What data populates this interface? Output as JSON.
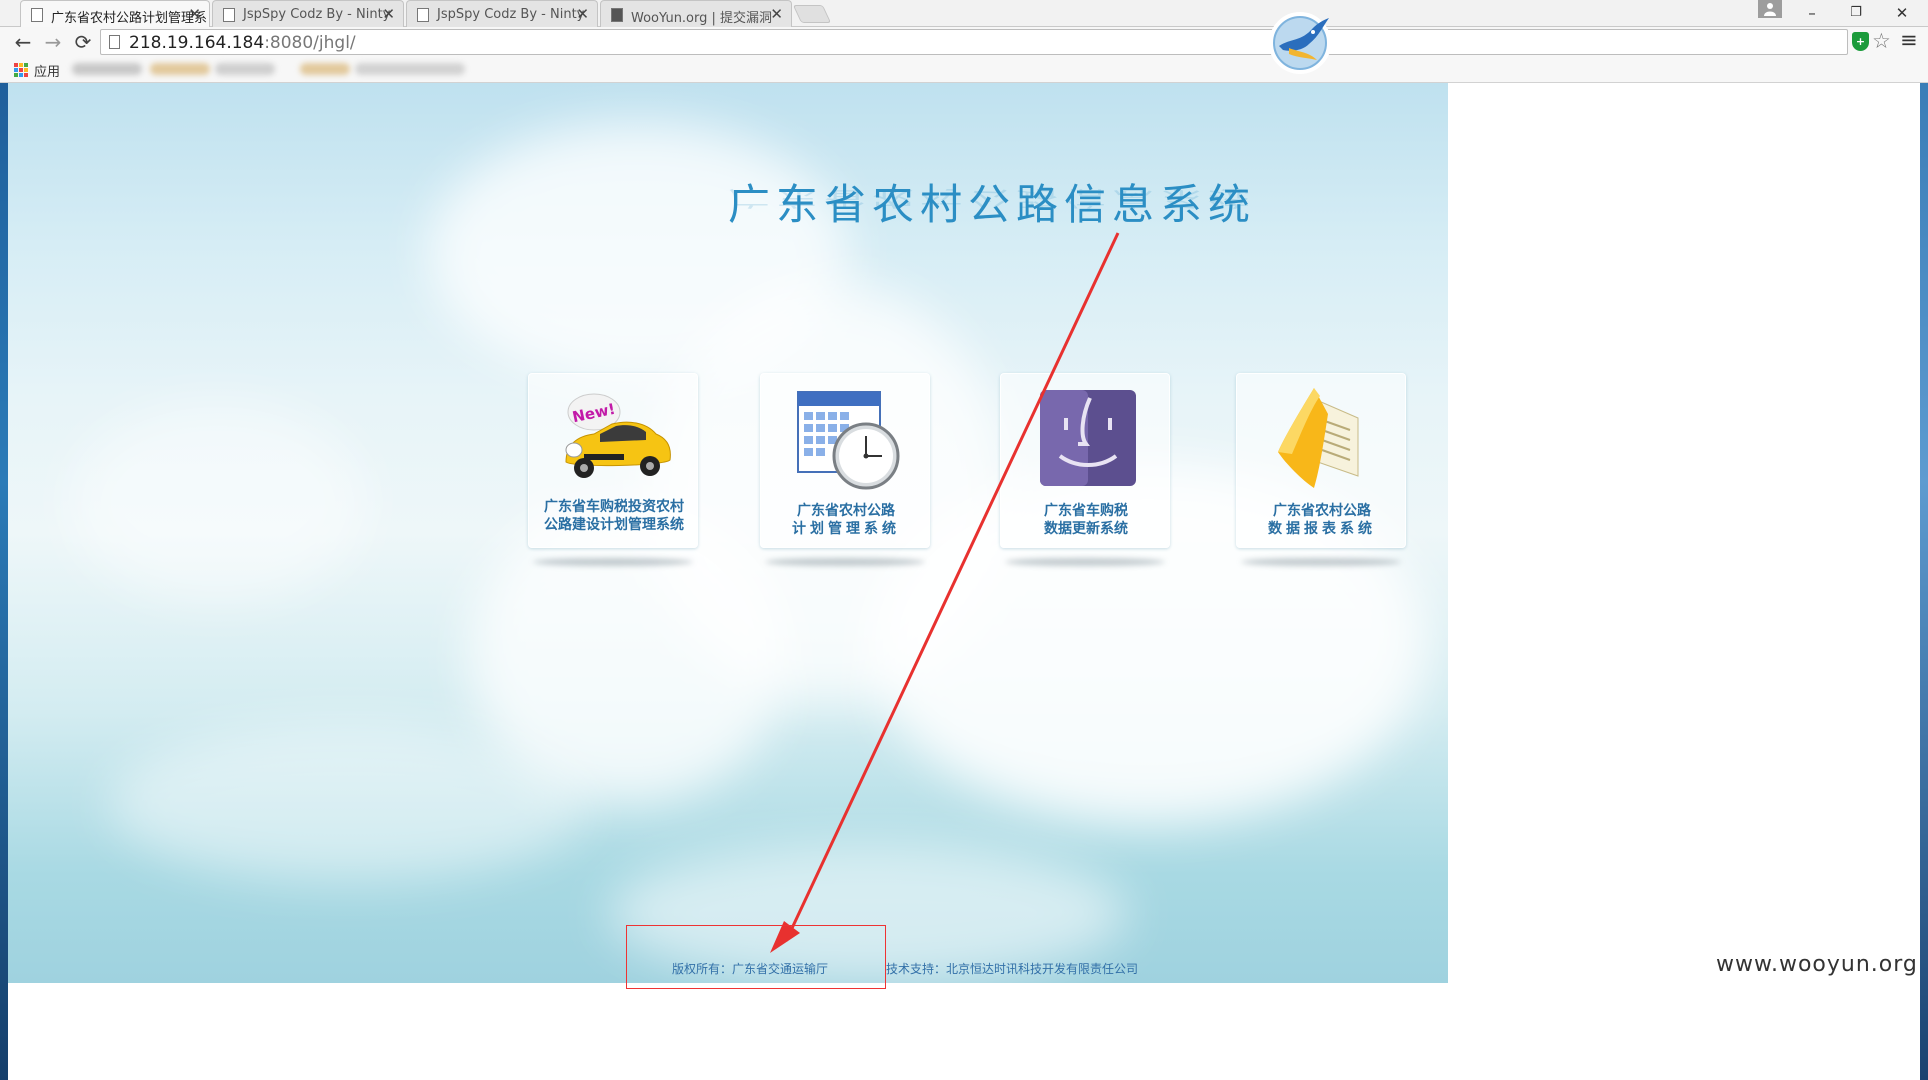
{
  "browser": {
    "tabs": [
      {
        "title": "广东省农村公路计划管理系",
        "close": "✕"
      },
      {
        "title": "JspSpy Codz By - Ninty",
        "close": "✕"
      },
      {
        "title": "JspSpy Codz By - Ninty",
        "close": "✕"
      },
      {
        "title": "WooYun.org | 提交漏洞",
        "close": "✕"
      }
    ],
    "controls": {
      "minimize": "–",
      "restore": "❐",
      "close": "✕"
    },
    "nav": {
      "back": "←",
      "forward": "→",
      "reload": "⟳"
    },
    "url_host": "218.19.164.184",
    "url_rest": ":8080/jhgl/",
    "bookmarks_apps_label": "应用",
    "icons": {
      "shield": "shield-icon",
      "star": "star-icon",
      "menu": "menu-icon"
    }
  },
  "page": {
    "title": "广东省农村公路信息系统",
    "tiles": [
      {
        "line1": "广东省车购税投资农村",
        "line2": "公路建设计划管理系统",
        "badge": "New!"
      },
      {
        "line1": "广东省农村公路",
        "line2": "计划管理系统"
      },
      {
        "line1": "广东省车购税",
        "line2": "数据更新系统"
      },
      {
        "line1": "广东省农村公路",
        "line2": "数据报表系统"
      }
    ],
    "footer": {
      "copyright": "版权所有：广东省交通运输厅",
      "support": "技术支持：北京恒达时讯科技开发有限责任公司"
    }
  },
  "watermark": "www.wooyun.org",
  "colors": {
    "title": "#2b8ec4",
    "tile_text": "#2a6fa3",
    "annotation_red": "#e8312f",
    "footer_text": "#3270a8"
  }
}
